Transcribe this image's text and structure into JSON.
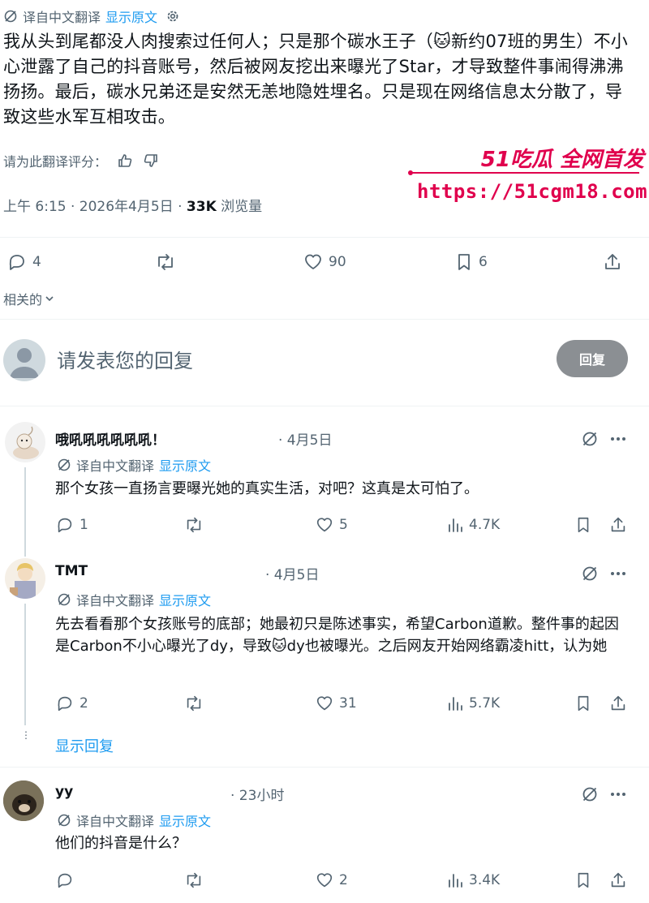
{
  "post": {
    "translated_label": "译自中文翻译",
    "show_original": "显示原文",
    "body": "我从头到尾都没人肉搜索过任何人；只是那个碳水王子（🐱新约07班的男生）不小心泄露了自己的抖音账号，然后被网友挖出来曝光了Star，才导致整件事闹得沸沸扬扬。最后，碳水兄弟还是安然无恙地隐姓埋名。只是现在网络信息太分散了，导致这些水军互相攻击。",
    "rate_label": "请为此翻译评分：",
    "time": "上午 6:15 · 2026年4月5日 · ",
    "views": "33K",
    "views_label": "浏览量",
    "replies": "4",
    "likes": "90",
    "bookmarks": "6",
    "related": "相关的"
  },
  "watermark": {
    "title": "51吃瓜 全网首发",
    "url": "https://51cgm18.com"
  },
  "reply_box": {
    "placeholder": "请发表您的回复",
    "button": "回复"
  },
  "comments": [
    {
      "name": "哦吼吼吼吼吼吼！",
      "date": "· 4月5日",
      "translated_label": "译自中文翻译",
      "show_original": "显示原文",
      "text": "那个女孩一直扬言要曝光她的真实生活，对吧？这真是太可怕了。",
      "replies": "1",
      "likes": "5",
      "views": "4.7K"
    },
    {
      "name": "TMT",
      "date": "· 4月5日",
      "translated_label": "译自中文翻译",
      "show_original": "显示原文",
      "text": "先去看看那个女孩账号的底部；她最初只是陈述事实，希望Carbon道歉。整件事的起因是Carbon不小心曝光了dy，导致🐱dy也被曝光。之后网友开始网络霸凌hitt，认为她",
      "replies": "2",
      "likes": "31",
      "views": "5.7K"
    },
    {
      "name": "yy",
      "date": "· 23小时",
      "translated_label": "译自中文翻译",
      "show_original": "显示原文",
      "text": "他们的抖音是什么？",
      "replies": "",
      "likes": "2",
      "views": "3.4K"
    }
  ],
  "show_replies": "显示回复",
  "colors": {
    "link": "#1d9bf0",
    "muted": "#536471",
    "watermark": "#e0004d",
    "reply_button": "#8b8f93"
  }
}
